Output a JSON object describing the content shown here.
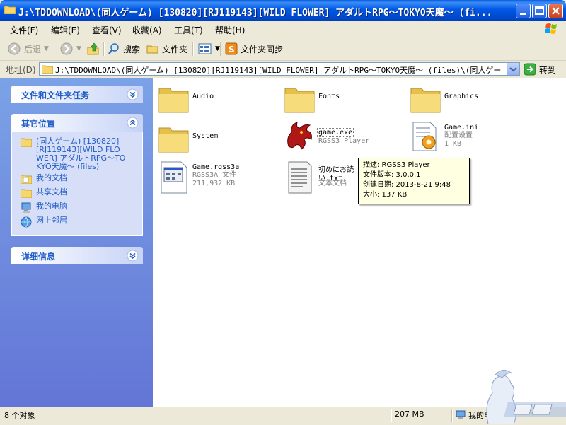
{
  "window": {
    "title": "J:\\TDDOWNLOAD\\(同人ゲーム) [130820][RJ119143][WILD FLOWER] アダルトRPG〜TOKYO天魔〜 (fi..."
  },
  "menu": {
    "items": [
      {
        "label": "文件(F)"
      },
      {
        "label": "编辑(E)"
      },
      {
        "label": "查看(V)"
      },
      {
        "label": "收藏(A)"
      },
      {
        "label": "工具(T)"
      },
      {
        "label": "帮助(H)"
      }
    ]
  },
  "toolbar": {
    "back_label": "后退",
    "search_label": "搜索",
    "folders_label": "文件夹",
    "sync_label": "文件夹同步"
  },
  "address": {
    "label": "地址(D)",
    "value": "J:\\TDDOWNLOAD\\(同人ゲーム) [130820][RJ119143][WILD FLOWER] アダルトRPG〜TOKYO天魔〜 (files)\\(同人ゲーム) [",
    "go_label": "转到"
  },
  "taskpane": {
    "file_tasks_title": "文件和文件夹任务",
    "other_places_title": "其它位置",
    "details_title": "详细信息",
    "places": [
      {
        "label": "(同人ゲーム) [130820][RJ119143][WILD FLOWER] アダルトRPG〜TOKYO天魔〜 (files)",
        "icon": "folder-icon"
      },
      {
        "label": "我的文档",
        "icon": "my-documents-icon"
      },
      {
        "label": "共享文档",
        "icon": "shared-folder-icon"
      },
      {
        "label": "我的电脑",
        "icon": "computer-icon"
      },
      {
        "label": "网上邻居",
        "icon": "network-icon"
      }
    ]
  },
  "files": [
    {
      "name": "Audio",
      "icon": "folder-icon"
    },
    {
      "name": "Fonts",
      "icon": "folder-icon"
    },
    {
      "name": "Graphics",
      "icon": "folder-icon"
    },
    {
      "name": "System",
      "icon": "folder-icon"
    },
    {
      "name": "game.exe",
      "type": "RGSS3 Player",
      "icon": "dragon-icon"
    },
    {
      "name": "Game.ini",
      "type": "配置设置",
      "size": "1 KB",
      "icon": "settings-file-icon"
    },
    {
      "name": "Game.rgss3a",
      "type": "RGSS3A 文件",
      "size": "211,932 KB",
      "icon": "generic-file-icon"
    },
    {
      "name_line1": "初めにお読",
      "name_line2": "い.txt",
      "type": "文本文档",
      "icon": "text-file-icon"
    }
  ],
  "tooltip": {
    "line1": "描述: RGSS3 Player",
    "line2": "文件版本: 3.0.0.1",
    "line3": "创建日期: 2013-8-21 9:48",
    "line4": "大小: 137 KB"
  },
  "status": {
    "count": "8 个对象",
    "size": "207 MB",
    "location": "我的电脑"
  },
  "colors": {
    "titlebar": "#0058e6",
    "taskpane": "#6f8ee0",
    "link": "#215dc6",
    "tooltip_bg": "#ffffe1"
  }
}
